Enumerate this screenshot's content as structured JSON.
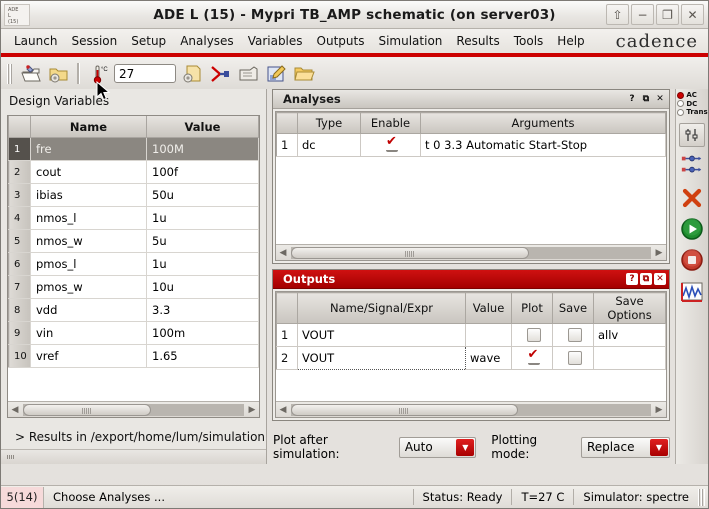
{
  "window": {
    "title": "ADE L (15) - Mypri TB_AMP schematic (on server03)",
    "icon_line1": "ADE",
    "icon_line2": "L",
    "icon_line3": "(15)",
    "buttons": {
      "rollup": "⇧",
      "minimize": "−",
      "maximize": "❐",
      "close": "✕"
    }
  },
  "menubar": {
    "items": [
      {
        "label": "Launch"
      },
      {
        "label": "Session"
      },
      {
        "label": "Setup"
      },
      {
        "label": "Analyses"
      },
      {
        "label": "Variables"
      },
      {
        "label": "Outputs"
      },
      {
        "label": "Simulation"
      },
      {
        "label": "Results"
      },
      {
        "label": "Tools"
      },
      {
        "label": "Help"
      }
    ],
    "brand": "cadence"
  },
  "toolbar": {
    "temperature_value": "27",
    "icons": [
      "open-design-icon",
      "setup-folder-icon",
      "temperature-icon",
      "netlist-setup-icon",
      "stop-simulation-icon",
      "save-state-icon",
      "edit-variables-icon",
      "open-results-icon"
    ]
  },
  "design_variables": {
    "label": "Design Variables",
    "columns": [
      "Name",
      "Value"
    ],
    "rows": [
      {
        "n": "1",
        "name": "fre",
        "value": "100M",
        "selected": true
      },
      {
        "n": "2",
        "name": "cout",
        "value": "100f",
        "selected": false
      },
      {
        "n": "3",
        "name": "ibias",
        "value": "50u",
        "selected": false
      },
      {
        "n": "4",
        "name": "nmos_l",
        "value": "1u",
        "selected": false
      },
      {
        "n": "5",
        "name": "nmos_w",
        "value": "5u",
        "selected": false
      },
      {
        "n": "6",
        "name": "pmos_l",
        "value": "1u",
        "selected": false
      },
      {
        "n": "7",
        "name": "pmos_w",
        "value": "10u",
        "selected": false
      },
      {
        "n": "8",
        "name": "vdd",
        "value": "3.3",
        "selected": false
      },
      {
        "n": "9",
        "name": "vin",
        "value": "100m",
        "selected": false
      },
      {
        "n": "10",
        "name": "vref",
        "value": "1.65",
        "selected": false
      }
    ],
    "results_line": "> Results in /export/home/lum/simulation/TB"
  },
  "analyses": {
    "title": "Analyses",
    "columns": [
      "Type",
      "Enable",
      "Arguments"
    ],
    "rows": [
      {
        "n": "1",
        "type": "dc",
        "enabled": true,
        "arguments": "t 0 3.3 Automatic Start-Stop"
      }
    ]
  },
  "outputs": {
    "title": "Outputs",
    "columns": [
      "Name/Signal/Expr",
      "Value",
      "Plot",
      "Save",
      "Save Options"
    ],
    "rows": [
      {
        "n": "1",
        "name": "VOUT",
        "value": "",
        "plot": false,
        "save": false,
        "save_options": "allv",
        "focused": false
      },
      {
        "n": "2",
        "name": "VOUT",
        "value": "wave",
        "plot": true,
        "save": false,
        "save_options": "",
        "focused": true
      }
    ]
  },
  "plot_controls": {
    "plot_after_label": "Plot after simulation:",
    "plot_after_value": "Auto",
    "plotting_mode_label": "Plotting mode:",
    "plotting_mode_value": "Replace"
  },
  "rail": {
    "analysis_modes": [
      {
        "label": "AC",
        "selected": true
      },
      {
        "label": "DC",
        "selected": false
      },
      {
        "label": "Trans",
        "selected": false
      }
    ],
    "icons": [
      "choose-analyses-icon",
      "edit-variables-rail-icon",
      "delete-icon",
      "run-simulation-icon",
      "stop-simulation-rail-icon",
      "plot-outputs-icon"
    ]
  },
  "statusbar": {
    "badge": "5(14)",
    "message": "Choose Analyses ...",
    "status": "Status: Ready",
    "temperature": "T=27 C",
    "simulator": "Simulator: spectre"
  },
  "colors": {
    "accent_red": "#cc0000",
    "active_title": "#a40000",
    "selection_gray": "#8b8781"
  }
}
